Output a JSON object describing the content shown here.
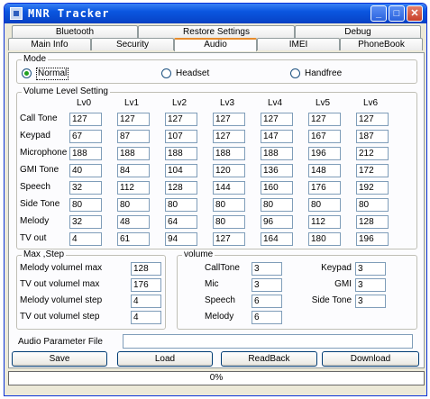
{
  "window": {
    "title": "MNR Tracker",
    "minimize": "_",
    "maximize": "□",
    "close": "✕"
  },
  "tabs_top": [
    "Bluetooth",
    "Restore Settings",
    "Debug"
  ],
  "tabs_bottom": [
    "Main Info",
    "Security",
    "Audio",
    "IMEI",
    "PhoneBook"
  ],
  "active_tab": "Audio",
  "mode": {
    "label": "Mode",
    "options": [
      "Normal",
      "Headset",
      "Handfree"
    ],
    "selected": "Normal"
  },
  "volume_level": {
    "label": "Volume Level Setting",
    "levels": [
      "Lv0",
      "Lv1",
      "Lv2",
      "Lv3",
      "Lv4",
      "Lv5",
      "Lv6"
    ],
    "rows": [
      {
        "name": "Call Tone",
        "values": [
          "127",
          "127",
          "127",
          "127",
          "127",
          "127",
          "127"
        ]
      },
      {
        "name": "Keypad",
        "values": [
          "67",
          "87",
          "107",
          "127",
          "147",
          "167",
          "187"
        ]
      },
      {
        "name": "Microphone",
        "values": [
          "188",
          "188",
          "188",
          "188",
          "188",
          "196",
          "212"
        ]
      },
      {
        "name": "GMI Tone",
        "values": [
          "40",
          "84",
          "104",
          "120",
          "136",
          "148",
          "172"
        ]
      },
      {
        "name": "Speech",
        "values": [
          "32",
          "112",
          "128",
          "144",
          "160",
          "176",
          "192"
        ]
      },
      {
        "name": "Side Tone",
        "values": [
          "80",
          "80",
          "80",
          "80",
          "80",
          "80",
          "80"
        ]
      },
      {
        "name": "Melody",
        "values": [
          "32",
          "48",
          "64",
          "80",
          "96",
          "112",
          "128"
        ]
      },
      {
        "name": "TV out",
        "values": [
          "4",
          "61",
          "94",
          "127",
          "164",
          "180",
          "196"
        ]
      }
    ]
  },
  "max_step": {
    "label": "Max ,Step",
    "rows": [
      {
        "name": "Melody volumel max",
        "value": "128"
      },
      {
        "name": "TV out volumel max",
        "value": "176"
      },
      {
        "name": "Melody volumel step",
        "value": "4"
      },
      {
        "name": "TV out volumel step",
        "value": "4"
      }
    ]
  },
  "volume": {
    "label": "volume",
    "left": [
      {
        "name": "CallTone",
        "value": "3"
      },
      {
        "name": "Mic",
        "value": "3"
      },
      {
        "name": "Speech",
        "value": "6"
      },
      {
        "name": "Melody",
        "value": "6"
      }
    ],
    "right": [
      {
        "name": "Keypad",
        "value": "3"
      },
      {
        "name": "GMI",
        "value": "3"
      },
      {
        "name": "Side Tone",
        "value": "3"
      }
    ]
  },
  "audio_file": {
    "label": "Audio Parameter File",
    "value": ""
  },
  "buttons": {
    "save": "Save",
    "load": "Load",
    "readback": "ReadBack",
    "download": "Download"
  },
  "progress": {
    "text": "0%",
    "value": 0
  }
}
